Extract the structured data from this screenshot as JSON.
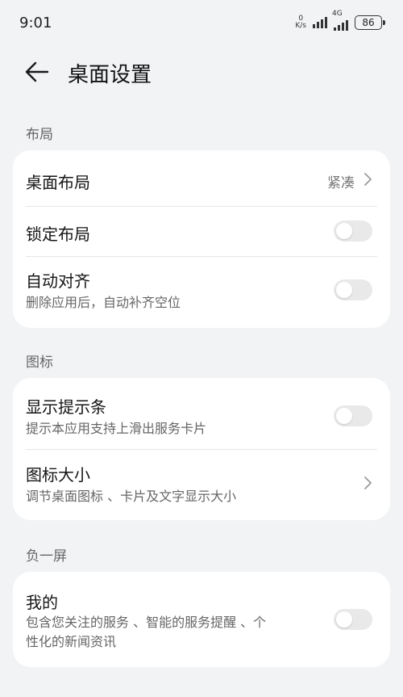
{
  "status_bar": {
    "time": "9:01",
    "net_speed_value": "0",
    "net_speed_unit": "K/s",
    "network_type": "4G",
    "battery": "86"
  },
  "header": {
    "title": "桌面设置"
  },
  "sections": {
    "layout": {
      "label": "布局",
      "desktop_layout": {
        "title": "桌面布局",
        "value": "紧凑"
      },
      "lock_layout": {
        "title": "锁定布局",
        "enabled": false
      },
      "auto_align": {
        "title": "自动对齐",
        "subtitle": "删除应用后，自动补齐空位",
        "enabled": false
      }
    },
    "icons": {
      "label": "图标",
      "show_hint_bar": {
        "title": "显示提示条",
        "subtitle": "提示本应用支持上滑出服务卡片",
        "enabled": false
      },
      "icon_size": {
        "title": "图标大小",
        "subtitle": "调节桌面图标 、卡片及文字显示大小"
      }
    },
    "minus_one_screen": {
      "label": "负一屏",
      "mine": {
        "title": "我的",
        "subtitle_line1": "包含您关注的服务 、智能的服务提醒 、个",
        "subtitle_line2": "性化的新闻资讯",
        "enabled": false
      }
    }
  },
  "colors": {
    "background": "#f1f3f5",
    "card": "#ffffff",
    "toggle_off": "#e9e9e9"
  }
}
